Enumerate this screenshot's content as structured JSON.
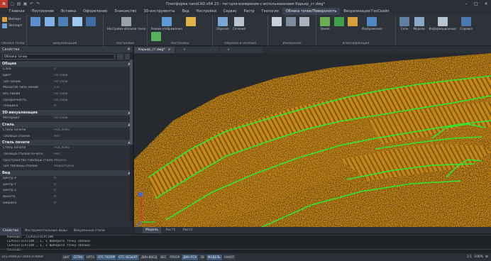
{
  "titlebar": {
    "title": "Платформа nanoCAD x64 23 - тестдля-измерения-с-использованием Карьер_ст.dwg*",
    "logo": "n"
  },
  "menu": {
    "tabs": [
      "Главная",
      "Построение",
      "Вставка",
      "Оформление",
      "Знакомство",
      "3D-инструменты",
      "Вид",
      "Настройки",
      "Сервис",
      "Растр",
      "Геология",
      "Облака точек/Поверхность",
      "Визуализация ГеоСкейп"
    ],
    "active_index": 11
  },
  "ribbon": {
    "groups": [
      {
        "label": "Облака точек",
        "buttons": [
          "Импорт",
          "Экспорт"
        ]
      },
      {
        "label": "Визуализация",
        "buttons": [
          "",
          "",
          "",
          "",
          ""
        ]
      },
      {
        "label": "Настройки",
        "buttons": [
          "Настройки облаков точек"
        ]
      },
      {
        "label": "Настройки",
        "buttons": [
          "Режим отображения",
          "",
          ""
        ]
      },
      {
        "label": "Обрезка и сечения",
        "buttons": [
          "Обрезка",
          "Сечения",
          ""
        ]
      },
      {
        "label": "Измерения",
        "buttons": [
          "",
          "",
          ""
        ]
      },
      {
        "label": "Классификация",
        "buttons": [
          "Земля",
          "",
          "",
          "Изображения"
        ]
      },
      {
        "label": "",
        "buttons": [
          "Сети",
          "Модели",
          "Информационные",
          "Справка"
        ]
      }
    ]
  },
  "properties": {
    "title": "Свойства",
    "selection": "Облака точек",
    "sections": [
      {
        "title": "Общие",
        "rows": [
          {
            "k": "Слой",
            "v": "0"
          },
          {
            "k": "Цвет",
            "v": "По слою"
          },
          {
            "k": "Тип линий",
            "v": "По слою"
          },
          {
            "k": "Масштаб типа линий",
            "v": "1.0"
          },
          {
            "k": "Вес линий",
            "v": "По слою"
          },
          {
            "k": "Прозрачность",
            "v": "По слою"
          },
          {
            "k": "Толщина",
            "v": "0"
          }
        ]
      },
      {
        "title": "3D-визуализация",
        "rows": [
          {
            "k": "Материал",
            "v": "По слою"
          }
        ]
      },
      {
        "title": "Стиль",
        "rows": [
          {
            "k": "Стиль печати",
            "v": "ПОСЛОЮ"
          },
          {
            "k": "Таблица стилей",
            "v": "Нет"
          }
        ]
      },
      {
        "title": "Стиль печати",
        "rows": [
          {
            "k": "Стиль печати",
            "v": "ПОСЛОЮ"
          },
          {
            "k": "Таблица стилей печати",
            "v": "Нет"
          },
          {
            "k": "Пространство таблицы стилей печати",
            "v": "Модель"
          },
          {
            "k": "Тип таблицы стилей",
            "v": "Недоступно"
          }
        ]
      },
      {
        "title": "Вид",
        "rows": [
          {
            "k": "Центр X",
            "v": "0"
          },
          {
            "k": "Центр Y",
            "v": "0"
          },
          {
            "k": "Центр Z",
            "v": "0"
          },
          {
            "k": "Высота",
            "v": "0"
          },
          {
            "k": "Ширина",
            "v": "0"
          }
        ]
      }
    ]
  },
  "left_tabs": [
    "Свойства",
    "Инструментальные виды",
    "Визуальные стили"
  ],
  "doc_tabs": [
    {
      "label": "Карьер_ст.dwg*",
      "active": true
    },
    {
      "label": "",
      "active": false
    },
    {
      "label": "",
      "active": false
    }
  ],
  "layout_tabs": [
    "Модель",
    "Лист1",
    "Лист2"
  ],
  "command_lines": [
    "Команда: _CLASSIFICATION",
    "CLASSIFICATION , 1, 1 Выберите точку облака: ",
    "CLASSIFICATION , 1, 1 Выберите точку облака: ",
    "Команда:"
  ],
  "statusbar": {
    "coords": "103.0000,87.0000,0.0000",
    "buttons": [
      {
        "label": "ШАГ",
        "on": false
      },
      {
        "label": "СЕТКА",
        "on": true
      },
      {
        "label": "ОРТО",
        "on": false
      },
      {
        "label": "ОТС-ПОЛЯР",
        "on": true
      },
      {
        "label": "ОТС-ОБЪЕКТ",
        "on": true
      },
      {
        "label": "ДИН-ВВОД",
        "on": false
      },
      {
        "label": "ВЕС",
        "on": false
      },
      {
        "label": "ПРОЗР",
        "on": false
      },
      {
        "label": "ДИН-ПСК",
        "on": true
      },
      {
        "label": "3D",
        "on": false
      },
      {
        "label": "МОДЕЛЬ",
        "on": true
      },
      {
        "label": "АННОТ",
        "on": false
      }
    ],
    "scale": "1:1",
    "zoom": "100%"
  },
  "colors": {
    "cloud": "#c98a1a",
    "cloud_dark": "#8a5a10",
    "breakline": "#2ee82e",
    "bg": "#262a2f"
  }
}
